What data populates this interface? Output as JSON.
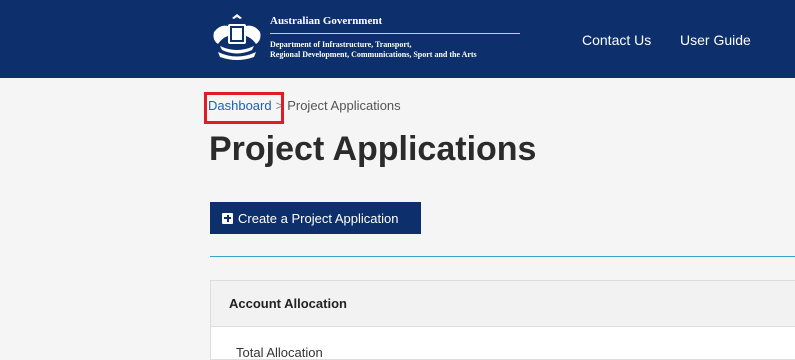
{
  "header": {
    "gov_title": "Australian Government",
    "department_line1": "Department of Infrastructure, Transport,",
    "department_line2": "Regional Development, Communications, Sport and the Arts",
    "nav": {
      "contact_label": "Contact Us",
      "guide_label": "User Guide"
    }
  },
  "breadcrumb": {
    "home_label": "Dashboard",
    "separator": ">",
    "current_label": "Project Applications"
  },
  "main": {
    "title": "Project Applications",
    "create_button_label": "Create a Project Application"
  },
  "allocation_panel": {
    "header": "Account Allocation",
    "first_row_label": "Total Allocation"
  },
  "colors": {
    "brand_navy": "#0d2f6b",
    "link": "#1f5fb5",
    "highlight": "#e01b24",
    "divider": "#3aa3c6"
  }
}
